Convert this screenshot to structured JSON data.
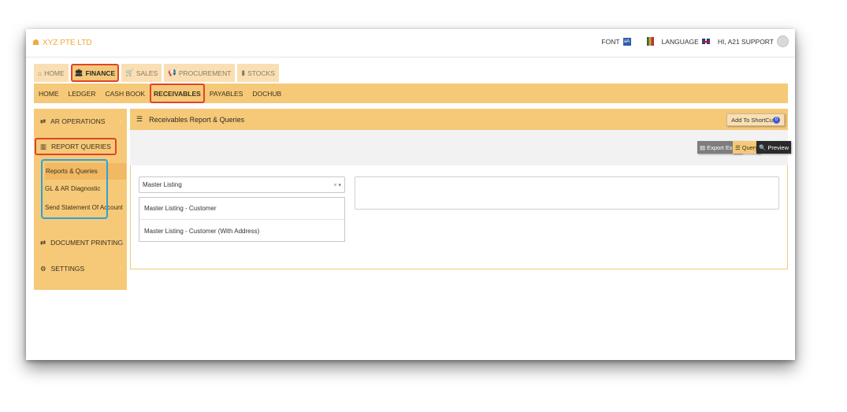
{
  "header": {
    "company": "XYZ PTE LTD",
    "font_label": "FONT",
    "font_icon_text": "aA",
    "language_label": "LANGUAGE",
    "user_greeting": "HI, A21 SUPPORT"
  },
  "modules": [
    {
      "label": "HOME",
      "icon": "home-icon",
      "active": false
    },
    {
      "label": "FINANCE",
      "icon": "bank-icon",
      "active": true
    },
    {
      "label": "SALES",
      "icon": "cart-icon",
      "active": false
    },
    {
      "label": "PROCUREMENT",
      "icon": "megaphone-icon",
      "active": false
    },
    {
      "label": "STOCKS",
      "icon": "bar-chart-icon",
      "active": false
    }
  ],
  "subnav": [
    "HOME",
    "LEDGER",
    "CASH BOOK",
    "RECEIVABLES",
    "PAYABLES",
    "DOCHUB"
  ],
  "subnav_active": "RECEIVABLES",
  "sidebar": {
    "items": [
      {
        "label": "AR OPERATIONS",
        "icon": "swap-icon"
      },
      {
        "label": "REPORT QUERIES",
        "icon": "bar-chart-icon"
      },
      {
        "label": "DOCUMENT PRINTING",
        "icon": "swap-icon"
      },
      {
        "label": "SETTINGS",
        "icon": "gears-icon"
      }
    ],
    "sub_items": [
      "Reports & Queries",
      "GL & AR Diagnostic",
      "Send Statement Of Account"
    ]
  },
  "main": {
    "title": "Receivables Report & Queries",
    "shortcut_label": "Add To ShortCut",
    "shortcut_badge": "0",
    "buttons": {
      "export": "Export Excel",
      "query": "Query",
      "preview": "Preview"
    },
    "select_value": "Master Listing",
    "select_clear": "×",
    "options": [
      "Master Listing - Customer",
      "Master Listing - Customer (With Address)"
    ]
  },
  "colors": {
    "accent": "#f6c978",
    "highlight_red": "#e2432b",
    "highlight_blue": "#2aa3d8"
  }
}
